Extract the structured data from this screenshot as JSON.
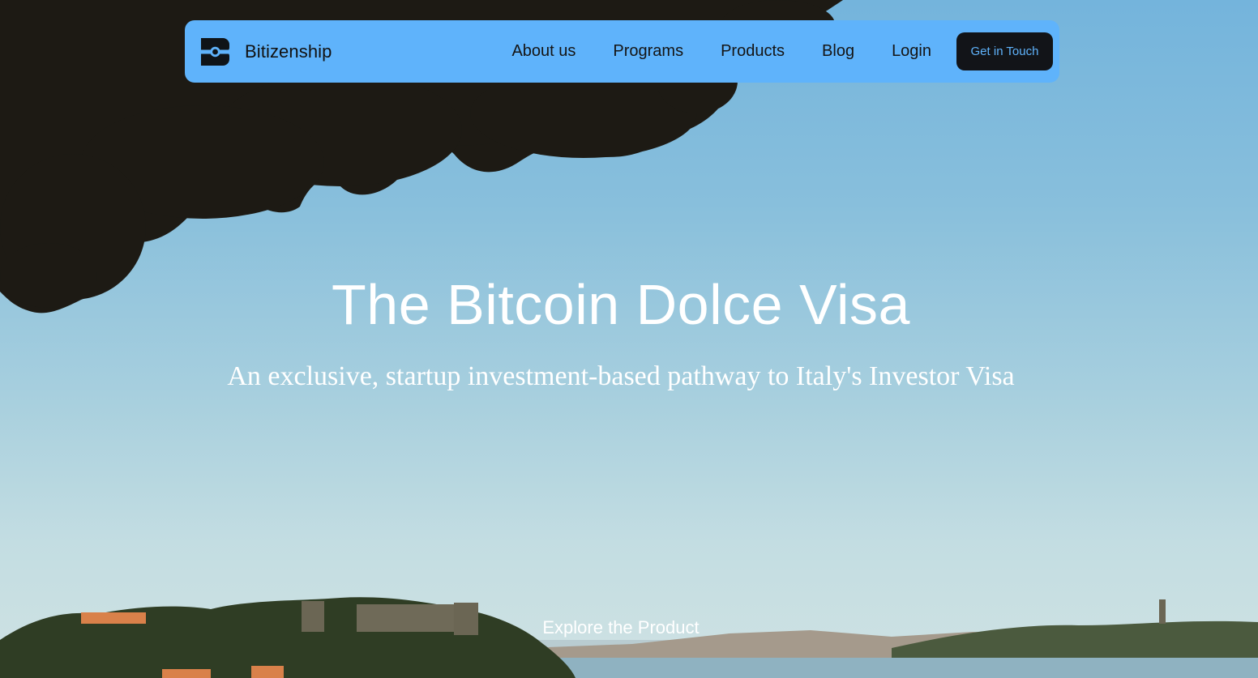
{
  "brand": {
    "name": "Bitizenship",
    "logo_icon": "bitizenship-logo-icon"
  },
  "nav": {
    "links": [
      "About us",
      "Programs",
      "Products",
      "Blog",
      "Login"
    ],
    "cta_label": "Get in Touch"
  },
  "hero": {
    "title": "The Bitcoin Dolce Visa",
    "subtitle": "An exclusive, startup investment-based pathway to Italy's Investor Visa",
    "explore_label": "Explore the Product"
  },
  "colors": {
    "navbar_bg": "#5fb3fb",
    "cta_bg": "#121418",
    "cta_text": "#5fb3fb",
    "hero_text": "#ffffff"
  }
}
